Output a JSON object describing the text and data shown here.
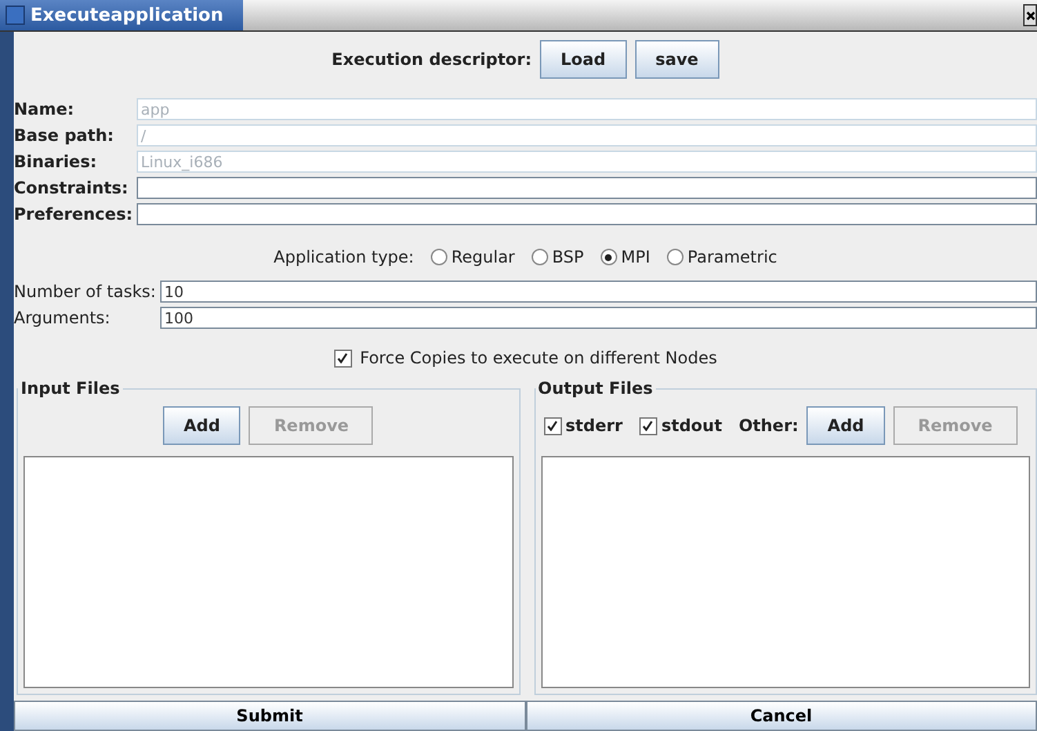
{
  "window": {
    "title": "Executeapplication"
  },
  "descriptor": {
    "label": "Execution descriptor:",
    "buttons": [
      {
        "label": "Load",
        "disabled": false
      },
      {
        "label": "save",
        "disabled": false
      }
    ]
  },
  "fields": [
    {
      "label": "Name:",
      "value": "app",
      "disabled": true
    },
    {
      "label": "Base path:",
      "value": "/",
      "disabled": true
    },
    {
      "label": "Binaries:",
      "value": "Linux_i686",
      "disabled": true
    },
    {
      "label": "Constraints:",
      "disabled": false
    },
    {
      "label": "Preferences:",
      "disabled": false
    }
  ],
  "application_type": {
    "label": "Application type:",
    "options": [
      {
        "label": "Regular",
        "selected": false
      },
      {
        "label": "BSP",
        "selected": false
      },
      {
        "label": "MPI",
        "selected": true
      },
      {
        "label": "Parametric",
        "selected": false
      }
    ]
  },
  "task_fields": [
    {
      "label": "Number of tasks:",
      "value": "10"
    },
    {
      "label": "Arguments:",
      "value": "100"
    }
  ],
  "force_copies": {
    "label": "Force Copies to execute on different Nodes",
    "checked": true
  },
  "input_files": {
    "title": "Input Files",
    "buttons": [
      {
        "label": "Add",
        "disabled": false
      },
      {
        "label": "Remove",
        "disabled": true
      }
    ]
  },
  "output_files": {
    "title": "Output Files",
    "checks": [
      {
        "label": "stderr",
        "checked": true
      },
      {
        "label": "stdout",
        "checked": true
      }
    ],
    "other_label": "Other:",
    "buttons": [
      {
        "label": "Add",
        "disabled": false
      },
      {
        "label": "Remove",
        "disabled": true
      }
    ]
  },
  "footer_buttons": [
    "Submit",
    "Cancel"
  ]
}
